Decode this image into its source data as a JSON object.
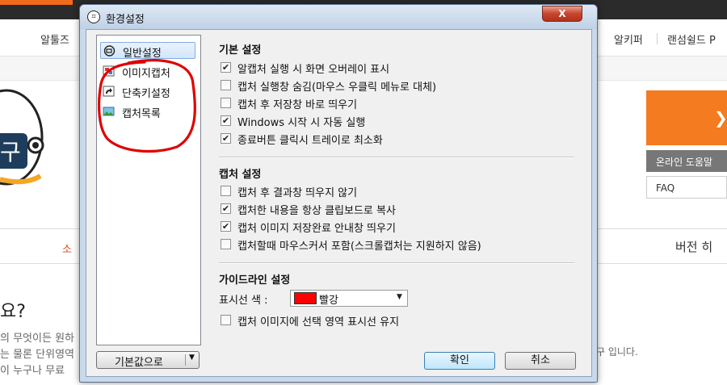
{
  "background": {
    "nav_items": [
      "알툴즈",
      "알키퍼",
      "랜섬쉴드 P"
    ],
    "help_button": "온라인 도움말",
    "faq": "FAQ",
    "tab_left": "소",
    "tab_right": "버전 히",
    "question": "요?",
    "lines": [
      "의 무엇이든 원하",
      "는 물론 단위영역",
      "이 누구나 무료"
    ],
    "line_right": "구 입니다."
  },
  "dialog": {
    "title": "환경설정",
    "close_label": "X",
    "nav": [
      {
        "label": "일반설정",
        "icon": "general-settings-icon",
        "selected": true
      },
      {
        "label": "이미지캡처",
        "icon": "image-capture-icon",
        "selected": false
      },
      {
        "label": "단축키설정",
        "icon": "shortcut-arrow-icon",
        "selected": false
      },
      {
        "label": "캡처목록",
        "icon": "capture-list-icon",
        "selected": false
      }
    ],
    "reset_button": "기본값으로",
    "sections": {
      "basic": {
        "title": "기본 설정",
        "options": [
          {
            "label": "알캡처 실행 시 화면 오버레이 표시",
            "checked": true
          },
          {
            "label": "캡처 실행창 숨김(마우스 우클릭 메뉴로 대체)",
            "checked": false
          },
          {
            "label": "캡처 후 저장창 바로 띄우기",
            "checked": false
          },
          {
            "label": "Windows 시작 시 자동 실행",
            "checked": true
          },
          {
            "label": "종료버튼 클릭시 트레이로 최소화",
            "checked": true
          }
        ]
      },
      "capture": {
        "title": "캡처 설정",
        "options": [
          {
            "label": "캡처 후 결과창 띄우지 않기",
            "checked": false
          },
          {
            "label": "캡처한 내용을 항상 클립보드로 복사",
            "checked": true
          },
          {
            "label": "캡처 이미지 저장완료 안내창 띄우기",
            "checked": true
          },
          {
            "label": "캡처할때 마우스커서 포함(스크롤캡처는 지원하지 않음)",
            "checked": false
          }
        ]
      },
      "guideline": {
        "title": "가이드라인 설정",
        "color_label": "표시선 색 :",
        "color_value": "빨강",
        "color_hex": "#ff0000",
        "options": [
          {
            "label": "캡처 이미지에 선택 영역 표시선 유지",
            "checked": false
          }
        ]
      }
    },
    "ok_button": "확인",
    "cancel_button": "취소"
  },
  "colors": {
    "annotation": "#e00000",
    "selection": "#84acdd",
    "brand_orange": "#f47b20"
  }
}
